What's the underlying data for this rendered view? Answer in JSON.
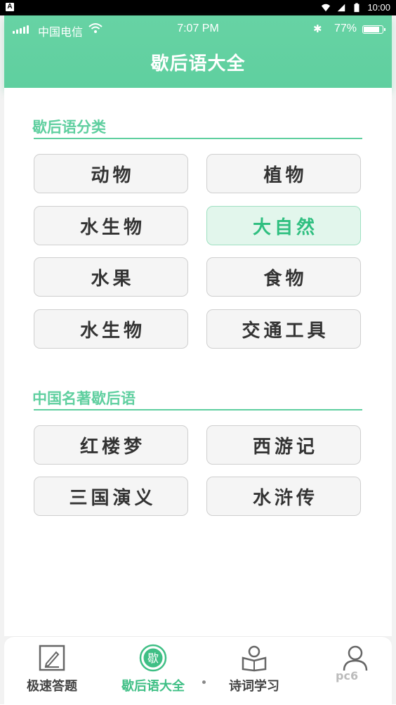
{
  "system_bar": {
    "time": "10:00",
    "left_icon": "A"
  },
  "status_bar": {
    "carrier": "中国电信",
    "time": "7:07 PM",
    "battery": "77%",
    "battery_level": 0.77
  },
  "header": {
    "title": "歇后语大全"
  },
  "sections": [
    {
      "title": "歇后语分类",
      "items": [
        "动物",
        "植物",
        "水生物",
        "大自然",
        "水果",
        "食物",
        "水生物",
        "交通工具"
      ],
      "active_index": 3
    },
    {
      "title": "中国名著歇后语",
      "items": [
        "红楼梦",
        "西游记",
        "三国演义",
        "水浒传"
      ]
    }
  ],
  "bottom_nav": {
    "items": [
      {
        "label": "极速答题",
        "icon": "edit-icon"
      },
      {
        "label": "歇后语大全",
        "icon": "xie-badge-icon",
        "active": true,
        "badge": "歇"
      },
      {
        "label": "诗词学习",
        "icon": "book-reader-icon"
      },
      {
        "label": "",
        "icon": "user-icon"
      }
    ]
  },
  "watermark": "pc6",
  "colors": {
    "accent": "#5fcf9f",
    "active_bg": "#e2f6ec",
    "active_text": "#2fbf80"
  }
}
